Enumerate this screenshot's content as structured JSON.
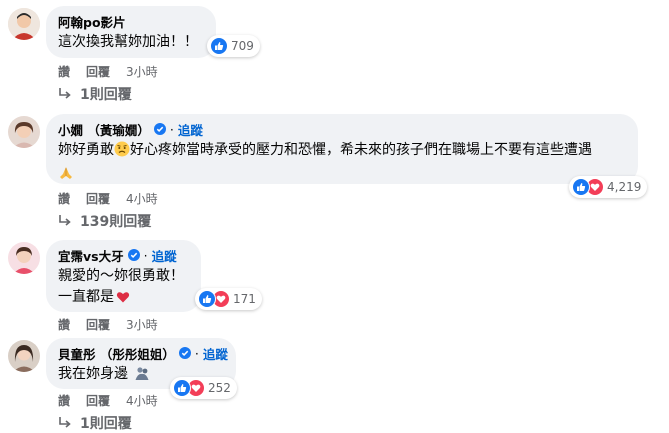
{
  "comments": [
    {
      "name": "阿翰po影片",
      "verified": false,
      "follow": "",
      "lines": [
        "這次換我幫妳加油！！"
      ],
      "reactions": {
        "types": [
          "like"
        ],
        "count": "709"
      },
      "actions": {
        "like": "讚",
        "reply": "回覆",
        "time": "3小時"
      },
      "replies": "1則回覆"
    },
    {
      "name": "小嫺 （黃瑜嫺）",
      "verified": true,
      "follow": "追蹤",
      "lines": [
        "妳好勇敢",
        "好心疼妳當時承受的壓力和恐懼，希未來的孩子們在職場上不要有這些遭遇"
      ],
      "reactions": {
        "types": [
          "like",
          "love"
        ],
        "count": "4,219"
      },
      "actions": {
        "like": "讚",
        "reply": "回覆",
        "time": "4小時"
      },
      "replies": "139則回覆"
    },
    {
      "name": "宜霈vs大牙",
      "verified": true,
      "follow": "追蹤",
      "lines": [
        "親愛的～妳很勇敢！",
        "一直都是"
      ],
      "reactions": {
        "types": [
          "like",
          "love"
        ],
        "count": "171"
      },
      "actions": {
        "like": "讚",
        "reply": "回覆",
        "time": "3小時"
      },
      "replies": ""
    },
    {
      "name": "貝童彤 （彤彤姐姐）",
      "verified": true,
      "follow": "追蹤",
      "lines": [
        "我在妳身邊"
      ],
      "reactions": {
        "types": [
          "like",
          "love"
        ],
        "count": "252"
      },
      "actions": {
        "like": "讚",
        "reply": "回覆",
        "time": "4小時"
      },
      "replies": "1則回覆"
    }
  ],
  "colors": {
    "like": "#1877f2",
    "love": "#f33e58",
    "link": "#0064d1",
    "bubble": "#f0f2f5",
    "meta": "#65676b"
  }
}
